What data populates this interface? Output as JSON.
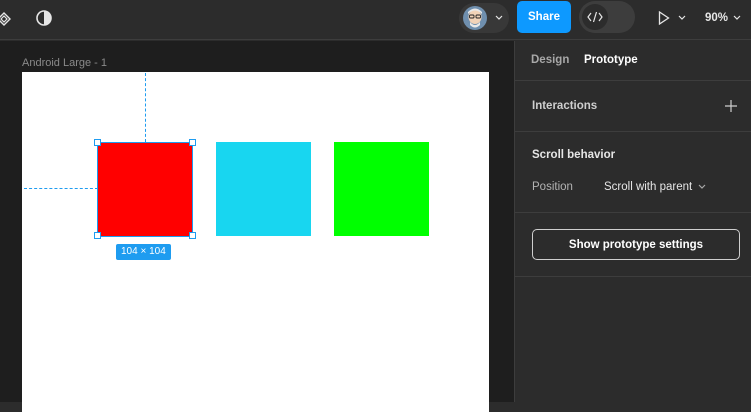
{
  "toolbar": {
    "share_label": "Share",
    "zoom_label": "90%",
    "icons": {
      "menu": "components-diamond-icon",
      "theme": "contrast-icon",
      "avatar": "user-avatar",
      "dev_mode": "code-brackets-icon",
      "play": "play-icon"
    },
    "colors": {
      "share_bg": "#0d99ff",
      "toolbar_bg": "#2c2c2c"
    }
  },
  "canvas": {
    "frame_label": "Android Large - 1",
    "selection_size": "104 × 104",
    "shapes": [
      {
        "name": "red-square",
        "color": "#ff0000"
      },
      {
        "name": "cyan-square",
        "color": "#18d6f0"
      },
      {
        "name": "green-square",
        "color": "#00ff00"
      }
    ],
    "selection_color": "#1e9cf0"
  },
  "panel": {
    "tabs": [
      {
        "label": "Design",
        "active": false
      },
      {
        "label": "Prototype",
        "active": true
      }
    ],
    "interactions_label": "Interactions",
    "scroll_behavior_title": "Scroll behavior",
    "position_label": "Position",
    "position_value": "Scroll with parent",
    "prototype_settings_button": "Show prototype settings"
  }
}
